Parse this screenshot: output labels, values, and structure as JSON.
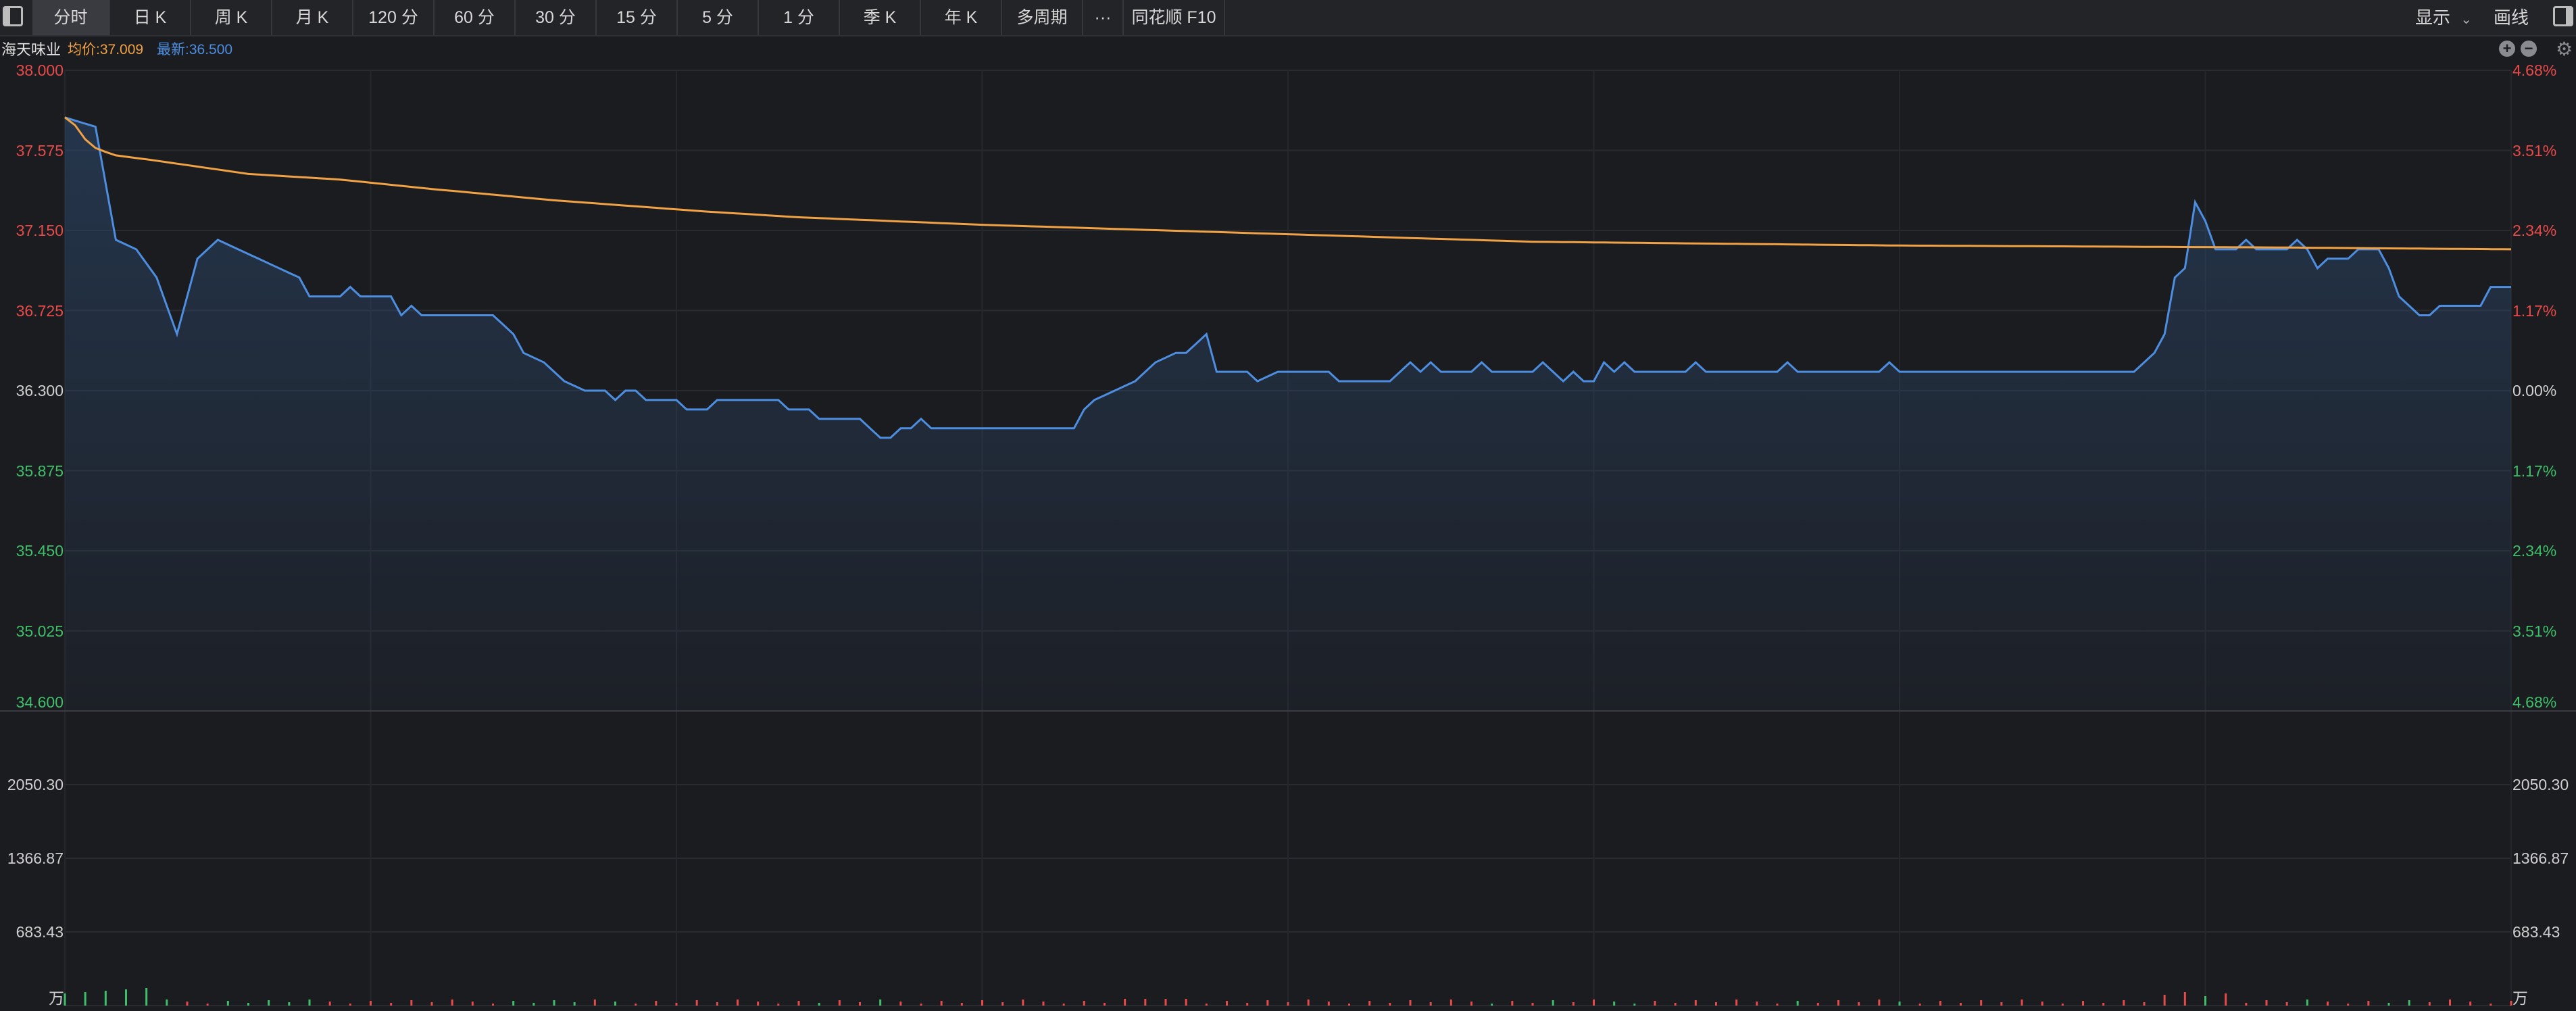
{
  "toolbar": {
    "tabs": [
      {
        "label": "分时",
        "active": true
      },
      {
        "label": "日 K"
      },
      {
        "label": "周 K"
      },
      {
        "label": "月 K"
      },
      {
        "label": "120 分"
      },
      {
        "label": "60 分"
      },
      {
        "label": "30 分"
      },
      {
        "label": "15 分"
      },
      {
        "label": "5 分"
      },
      {
        "label": "1 分"
      },
      {
        "label": "季 K"
      },
      {
        "label": "年 K"
      },
      {
        "label": "多周期"
      },
      {
        "label": "···"
      },
      {
        "label": "同花顺 F10"
      }
    ],
    "display_label": "显示",
    "draw_label": "画线"
  },
  "info": {
    "stock_name": "海天味业",
    "avg_price": "均价:37.009",
    "last_price": "最新:36.500"
  },
  "colors": {
    "price_line": "#4d8ee0",
    "avg_line": "#f0a244",
    "up": "#e84a4a",
    "down": "#3fbf6a",
    "neutral": "#d0d0d0",
    "background": "#1b1c20"
  },
  "chart_data": {
    "type": "line",
    "prev_close": 36.3,
    "ylim": [
      34.6,
      38.0
    ],
    "left_ticks": [
      "38.000",
      "37.575",
      "37.150",
      "36.725",
      "36.300",
      "35.875",
      "35.450",
      "35.025",
      "34.600"
    ],
    "right_ticks": [
      "4.68%",
      "3.51%",
      "2.34%",
      "1.17%",
      "0.00%",
      "1.17%",
      "2.34%",
      "3.51%",
      "4.68%"
    ],
    "x_points": 241,
    "series": [
      {
        "name": "最新",
        "keyframes": [
          [
            0,
            37.75
          ],
          [
            3,
            37.7
          ],
          [
            5,
            37.1
          ],
          [
            7,
            37.05
          ],
          [
            9,
            36.9
          ],
          [
            11,
            36.6
          ],
          [
            13,
            37.0
          ],
          [
            15,
            37.1
          ],
          [
            17,
            37.05
          ],
          [
            19,
            37.0
          ],
          [
            21,
            36.95
          ],
          [
            23,
            36.9
          ],
          [
            24,
            36.8
          ],
          [
            27,
            36.8
          ],
          [
            28,
            36.85
          ],
          [
            29,
            36.8
          ],
          [
            31,
            36.8
          ],
          [
            32,
            36.8
          ],
          [
            33,
            36.7
          ],
          [
            34,
            36.75
          ],
          [
            35,
            36.7
          ],
          [
            42,
            36.7
          ],
          [
            43,
            36.65
          ],
          [
            44,
            36.6
          ],
          [
            45,
            36.5
          ],
          [
            47,
            36.45
          ],
          [
            49,
            36.35
          ],
          [
            51,
            36.3
          ],
          [
            53,
            36.3
          ],
          [
            54,
            36.25
          ],
          [
            55,
            36.3
          ],
          [
            56,
            36.3
          ],
          [
            57,
            36.25
          ],
          [
            60,
            36.25
          ],
          [
            61,
            36.2
          ],
          [
            63,
            36.2
          ],
          [
            64,
            36.25
          ],
          [
            70,
            36.25
          ],
          [
            71,
            36.2
          ],
          [
            73,
            36.2
          ],
          [
            74,
            36.15
          ],
          [
            78,
            36.15
          ],
          [
            79,
            36.1
          ],
          [
            80,
            36.05
          ],
          [
            81,
            36.05
          ],
          [
            82,
            36.1
          ],
          [
            83,
            36.1
          ],
          [
            84,
            36.15
          ],
          [
            85,
            36.1
          ],
          [
            99,
            36.1
          ],
          [
            100,
            36.2
          ],
          [
            101,
            36.25
          ],
          [
            103,
            36.3
          ],
          [
            105,
            36.35
          ],
          [
            106,
            36.4
          ],
          [
            107,
            36.45
          ],
          [
            109,
            36.5
          ],
          [
            110,
            36.5
          ],
          [
            111,
            36.55
          ],
          [
            112,
            36.6
          ],
          [
            113,
            36.4
          ],
          [
            115,
            36.4
          ],
          [
            116,
            36.4
          ],
          [
            117,
            36.35
          ],
          [
            119,
            36.4
          ],
          [
            124,
            36.4
          ],
          [
            125,
            36.35
          ],
          [
            130,
            36.35
          ],
          [
            131,
            36.4
          ],
          [
            132,
            36.45
          ],
          [
            133,
            36.4
          ],
          [
            134,
            36.45
          ],
          [
            135,
            36.4
          ],
          [
            138,
            36.4
          ],
          [
            139,
            36.45
          ],
          [
            140,
            36.4
          ],
          [
            144,
            36.4
          ],
          [
            145,
            36.45
          ],
          [
            146,
            36.4
          ],
          [
            147,
            36.35
          ],
          [
            148,
            36.4
          ],
          [
            149,
            36.35
          ],
          [
            150,
            36.35
          ],
          [
            151,
            36.45
          ],
          [
            152,
            36.4
          ],
          [
            153,
            36.45
          ],
          [
            154,
            36.4
          ],
          [
            159,
            36.4
          ],
          [
            160,
            36.45
          ],
          [
            161,
            36.4
          ],
          [
            168,
            36.4
          ],
          [
            169,
            36.45
          ],
          [
            170,
            36.4
          ],
          [
            178,
            36.4
          ],
          [
            179,
            36.45
          ],
          [
            180,
            36.4
          ],
          [
            203,
            36.4
          ],
          [
            204,
            36.45
          ],
          [
            205,
            36.5
          ],
          [
            206,
            36.6
          ],
          [
            207,
            36.9
          ],
          [
            208,
            36.95
          ],
          [
            209,
            37.3
          ],
          [
            210,
            37.2
          ],
          [
            211,
            37.05
          ],
          [
            213,
            37.05
          ],
          [
            214,
            37.1
          ],
          [
            215,
            37.05
          ],
          [
            218,
            37.05
          ],
          [
            219,
            37.1
          ],
          [
            220,
            37.05
          ],
          [
            221,
            36.95
          ],
          [
            222,
            37.0
          ],
          [
            224,
            37.0
          ],
          [
            225,
            37.05
          ],
          [
            227,
            37.05
          ],
          [
            228,
            36.95
          ],
          [
            229,
            36.8
          ],
          [
            230,
            36.75
          ],
          [
            231,
            36.7
          ],
          [
            232,
            36.7
          ],
          [
            233,
            36.75
          ],
          [
            235,
            36.75
          ],
          [
            237,
            36.75
          ],
          [
            238,
            36.85
          ],
          [
            240,
            36.85
          ]
        ]
      },
      {
        "name": "均价",
        "keyframes": [
          [
            0,
            37.75
          ],
          [
            2,
            37.7
          ],
          [
            4,
            37.6
          ],
          [
            8,
            37.55
          ],
          [
            15,
            37.52
          ],
          [
            30,
            37.45
          ],
          [
            45,
            37.42
          ],
          [
            60,
            37.37
          ],
          [
            80,
            37.31
          ],
          [
            105,
            37.25
          ],
          [
            120,
            37.22
          ],
          [
            150,
            37.18
          ],
          [
            200,
            37.13
          ],
          [
            240,
            37.09
          ],
          [
            300,
            37.07
          ],
          [
            360,
            37.06
          ],
          [
            400,
            37.05
          ]
        ]
      }
    ],
    "volume": {
      "unit": "万",
      "ticks": [
        "2050.30",
        "1366.87",
        "683.43"
      ],
      "max": 2733.73
    }
  }
}
